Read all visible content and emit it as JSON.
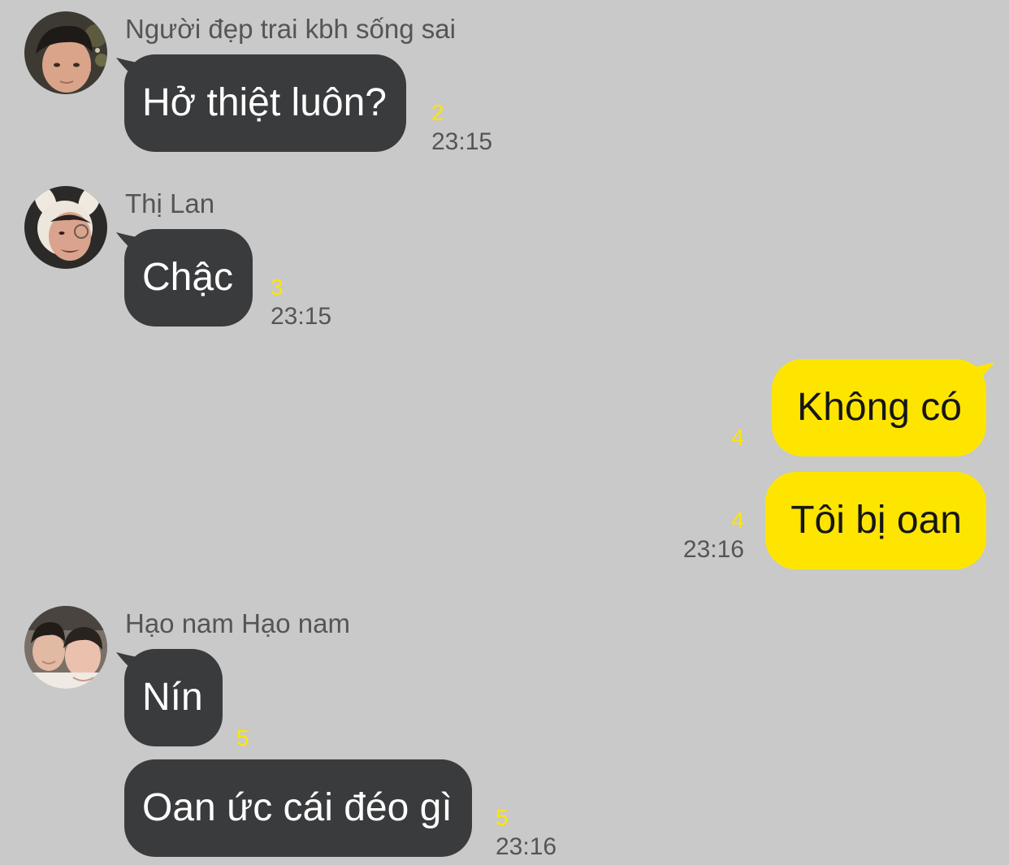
{
  "colors": {
    "background": "#c9c9c9",
    "incoming_bubble": "#3a3b3d",
    "outgoing_bubble": "#fee500",
    "unread_count": "#fee500",
    "meta_text": "#555555"
  },
  "messages": [
    {
      "sender": "Người đẹp trai kbh sống sai",
      "avatar_icon": "user-avatar-photo",
      "bubbles": [
        {
          "text": "Hở thiệt luôn?",
          "unread": "2",
          "time": "23:15"
        }
      ]
    },
    {
      "sender": "Thị Lan",
      "avatar_icon": "user-avatar-photo",
      "bubbles": [
        {
          "text": "Chậc",
          "unread": "3",
          "time": "23:15"
        }
      ]
    },
    {
      "sender": "",
      "outgoing": true,
      "bubbles": [
        {
          "text": "Không có",
          "unread": "4",
          "time": ""
        },
        {
          "text": "Tôi bị oan",
          "unread": "4",
          "time": "23:16"
        }
      ]
    },
    {
      "sender": "Hạo nam Hạo nam",
      "avatar_icon": "user-avatar-photo",
      "bubbles": [
        {
          "text": "Nín",
          "unread": "5",
          "time": ""
        },
        {
          "text": "Oan ức cái đéo gì",
          "unread": "5",
          "time": "23:16"
        }
      ]
    }
  ]
}
